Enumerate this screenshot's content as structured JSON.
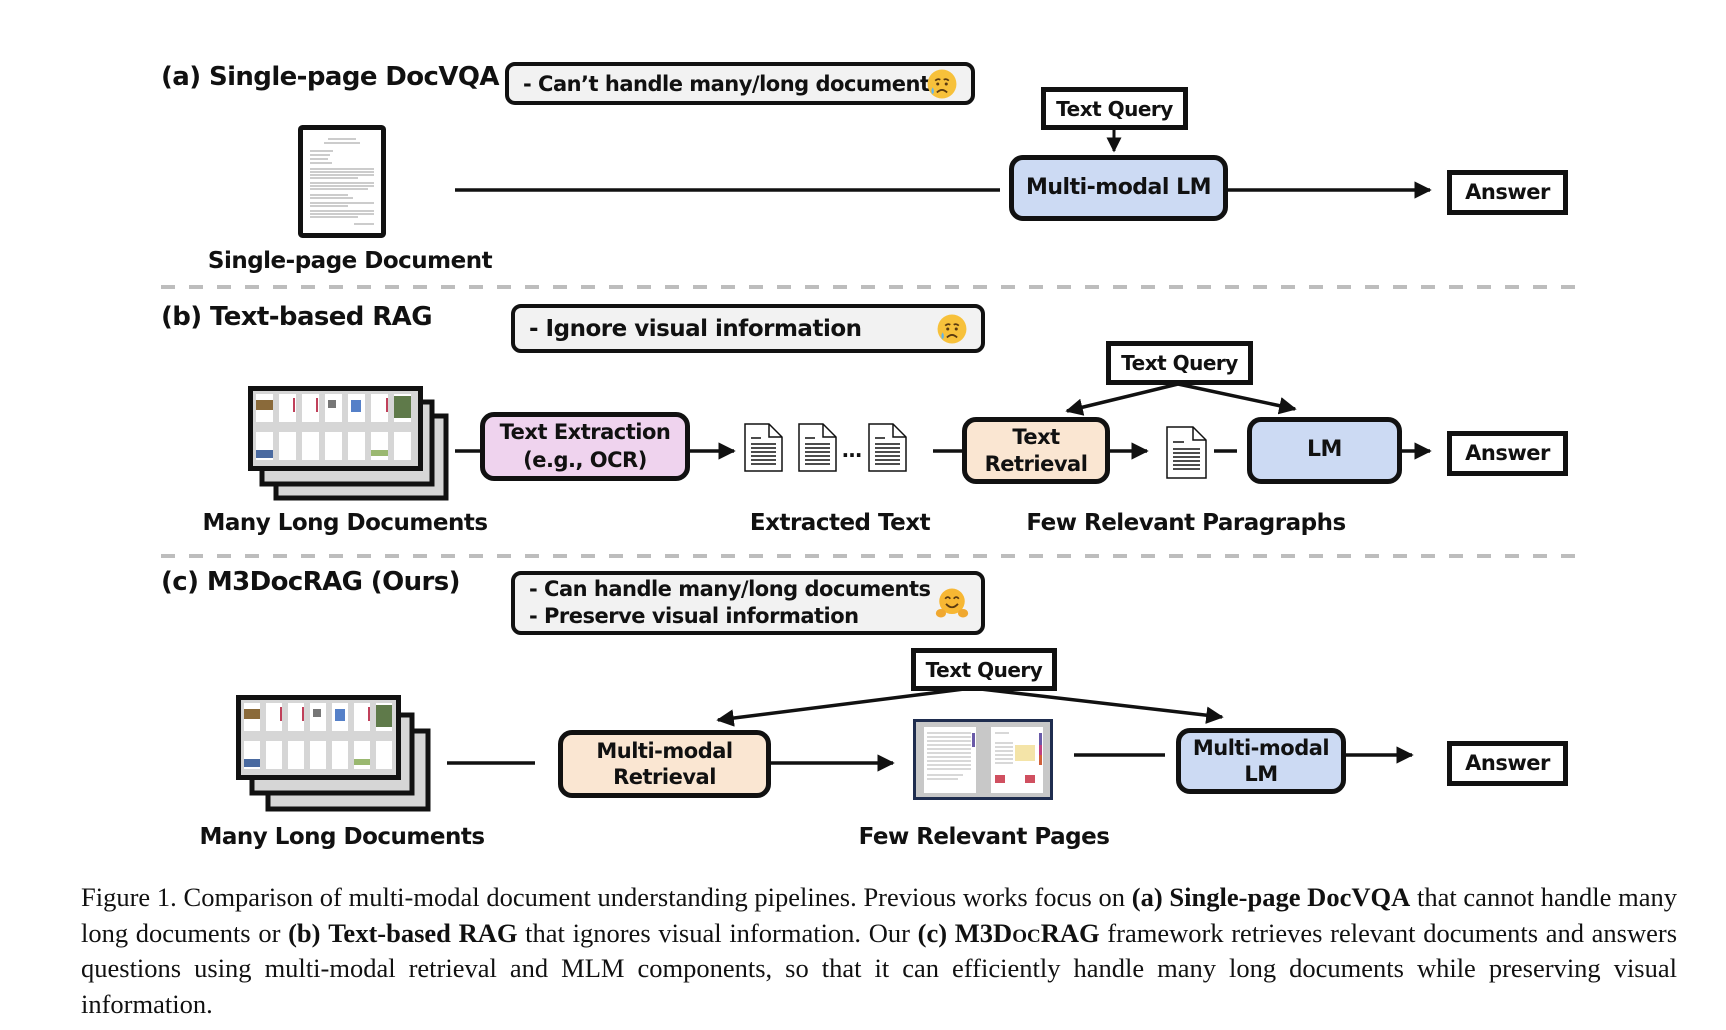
{
  "figure": {
    "panels": {
      "a": {
        "title": "(a) Single-page DocVQA",
        "note_lines": [
          "- Can’t handle many/long documents"
        ],
        "note_emoji": "sad-relieved-face-emoji",
        "input_label": "Single-page Document",
        "query_label": "Text Query",
        "model_label": "Multi-modal LM",
        "answer_label": "Answer"
      },
      "b": {
        "title": "(b) Text-based RAG",
        "note_lines": [
          "- Ignore visual information"
        ],
        "note_emoji": "sad-relieved-face-emoji",
        "input_label": "Many Long Documents",
        "extraction_label_1": "Text Extraction",
        "extraction_label_2": "(e.g., OCR)",
        "extracted_label": "Extracted Text",
        "ellipsis": "…",
        "query_label": "Text Query",
        "retrieval_label_1": "Text",
        "retrieval_label_2": "Retrieval",
        "paragraphs_label": "Few Relevant Paragraphs",
        "model_label": "LM",
        "answer_label": "Answer"
      },
      "c": {
        "title": "(c) M3DocRAG (Ours)",
        "note_lines": [
          "- Can handle many/long documents",
          "- Preserve visual information"
        ],
        "note_emoji": "hugging-face-emoji",
        "input_label": "Many Long Documents",
        "query_label": "Text Query",
        "retrieval_label_1": "Multi-modal",
        "retrieval_label_2": "Retrieval",
        "pages_label": "Few Relevant Pages",
        "model_label_1": "Multi-modal",
        "model_label_2": "LM",
        "answer_label": "Answer"
      }
    },
    "colors": {
      "lm_fill": "#ccdaf3",
      "retrieval_fill": "#fae6d2",
      "extraction_fill": "#efd3ee",
      "note_fill": "#f2f2f2",
      "separator": "#bdbdbd",
      "pages_frame": "#1f2d4f"
    },
    "caption": {
      "prefix": "Figure 1. Comparison of multi-modal document understanding pipelines. Previous works focus on ",
      "a_tag": "(a)",
      "a_name": "Single-page DocVQA",
      "mid1": " that cannot handle many long documents or ",
      "b_tag": "(b)",
      "b_name": "Text-based RAG",
      "mid2": " that ignores visual information. Our ",
      "c_tag": "(c)",
      "c_name_1": "M3D",
      "c_name_sc": "oc",
      "c_name_2": "RAG",
      "suffix": " framework retrieves relevant documents and answers questions using multi-modal retrieval and MLM components, so that it can efficiently handle many long documents while preserving visual information."
    }
  }
}
